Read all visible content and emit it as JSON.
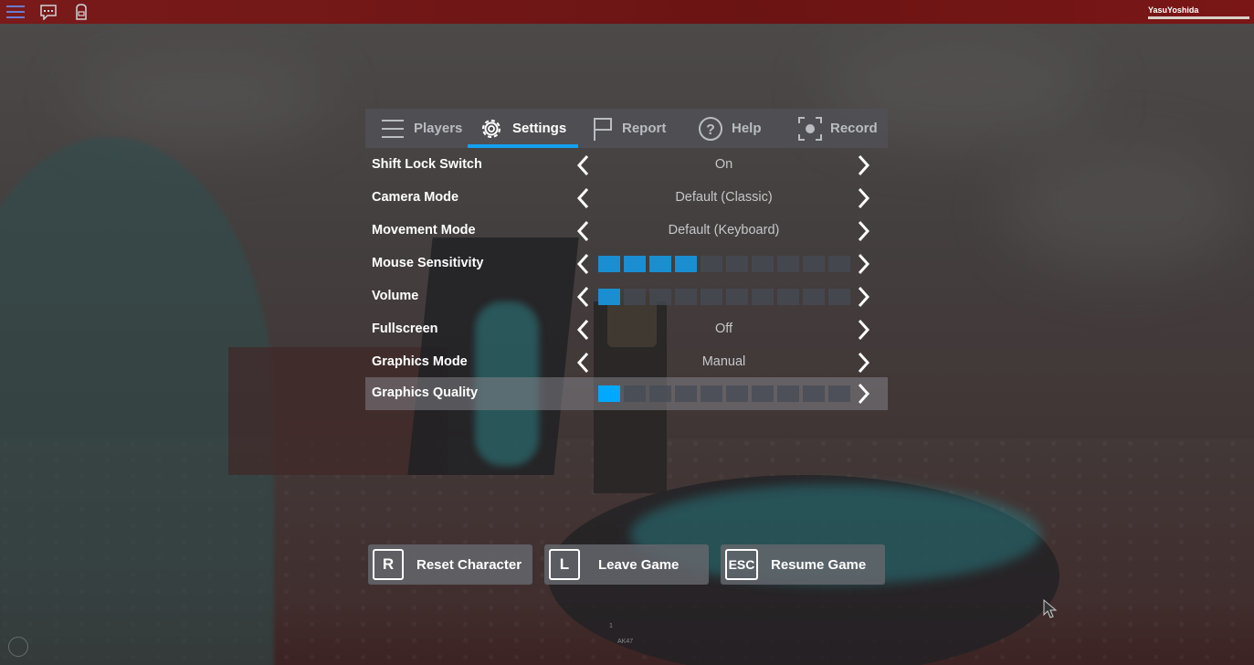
{
  "topbar": {
    "username": "YasuYoshida"
  },
  "tabs": [
    {
      "label": "Players",
      "icon": "list-icon"
    },
    {
      "label": "Settings",
      "icon": "gear-icon",
      "active": true
    },
    {
      "label": "Report",
      "icon": "flag-icon"
    },
    {
      "label": "Help",
      "icon": "question-icon"
    },
    {
      "label": "Record",
      "icon": "camera-icon"
    }
  ],
  "settings": {
    "shift_lock": {
      "label": "Shift Lock Switch",
      "value": "On"
    },
    "camera_mode": {
      "label": "Camera Mode",
      "value": "Default (Classic)"
    },
    "movement_mode": {
      "label": "Movement Mode",
      "value": "Default (Keyboard)"
    },
    "mouse_sensitivity": {
      "label": "Mouse Sensitivity",
      "level": 4,
      "max": 10
    },
    "volume": {
      "label": "Volume",
      "level": 1,
      "max": 10
    },
    "fullscreen": {
      "label": "Fullscreen",
      "value": "Off"
    },
    "graphics_mode": {
      "label": "Graphics Mode",
      "value": "Manual"
    },
    "graphics_quality": {
      "label": "Graphics Quality",
      "level": 1,
      "max": 10
    }
  },
  "actions": {
    "reset": {
      "key": "R",
      "label": "Reset Character"
    },
    "leave": {
      "key": "L",
      "label": "Leave Game"
    },
    "resume": {
      "key": "ESC",
      "label": "Resume Game"
    }
  },
  "hud": {
    "slot_number": "1",
    "slot_label": "AK47"
  },
  "colors": {
    "accent": "#13a0f0",
    "slider_on": "#1a8ed0",
    "topbar": "#7a1a1a"
  }
}
